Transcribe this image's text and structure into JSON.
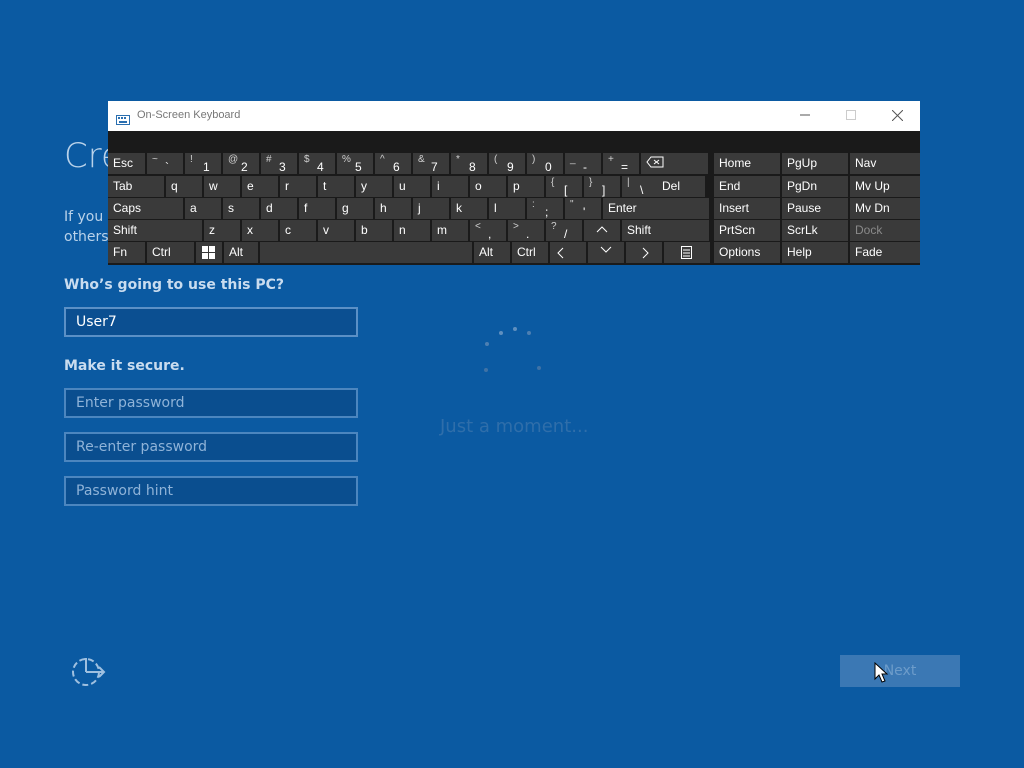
{
  "setup": {
    "title": "Cre",
    "subtitle_line1": "If you v",
    "subtitle_line2": "others",
    "who_label": "Who’s going to use this PC?",
    "username_value": "User7",
    "secure_label": "Make it secure.",
    "password_placeholder": "Enter password",
    "reenter_placeholder": "Re-enter password",
    "hint_placeholder": "Password hint",
    "next_label": "Next",
    "ease_icon": "ease-of-access-icon"
  },
  "overlay": {
    "message": "Just a moment..."
  },
  "osk": {
    "title": "On-Screen Keyboard",
    "icon": "keyboard-icon",
    "controls": [
      "minimize",
      "maximize",
      "close"
    ],
    "row1": {
      "esc": "Esc",
      "pairs": [
        {
          "shift": "~",
          "base": "`"
        },
        {
          "shift": "!",
          "base": "1"
        },
        {
          "shift": "@",
          "base": "2"
        },
        {
          "shift": "#",
          "base": "3"
        },
        {
          "shift": "$",
          "base": "4"
        },
        {
          "shift": "%",
          "base": "5"
        },
        {
          "shift": "^",
          "base": "6"
        },
        {
          "shift": "&",
          "base": "7"
        },
        {
          "shift": "*",
          "base": "8"
        },
        {
          "shift": "(",
          "base": "9"
        },
        {
          "shift": ")",
          "base": "0"
        },
        {
          "shift": "_",
          "base": "-"
        },
        {
          "shift": "+",
          "base": "="
        }
      ],
      "backspace_icon": "backspace-icon"
    },
    "row2": {
      "tab": "Tab",
      "letters": [
        "q",
        "w",
        "e",
        "r",
        "t",
        "y",
        "u",
        "i",
        "o",
        "p"
      ],
      "pairs": [
        {
          "shift": "{",
          "base": "["
        },
        {
          "shift": "}",
          "base": "]"
        },
        {
          "shift": "|",
          "base": "\\"
        }
      ],
      "del": "Del"
    },
    "row3": {
      "caps": "Caps",
      "letters": [
        "a",
        "s",
        "d",
        "f",
        "g",
        "h",
        "j",
        "k",
        "l"
      ],
      "pairs": [
        {
          "shift": ":",
          "base": ";"
        },
        {
          "shift": "\"",
          "base": "'"
        }
      ],
      "enter": "Enter"
    },
    "row4": {
      "shift_left": "Shift",
      "letters": [
        "z",
        "x",
        "c",
        "v",
        "b",
        "n",
        "m"
      ],
      "pairs": [
        {
          "shift": "<",
          "base": ","
        },
        {
          "shift": ">",
          "base": "."
        },
        {
          "shift": "?",
          "base": "/"
        }
      ],
      "shift_right": "Shift"
    },
    "row5": {
      "fn": "Fn",
      "ctrl_left": "Ctrl",
      "win_icon": "windows-logo-icon",
      "alt_left": "Alt",
      "alt_right": "Alt",
      "ctrl_right": "Ctrl",
      "menu_icon": "context-menu-icon"
    },
    "nav_block": [
      [
        "Home",
        "PgUp",
        "Nav"
      ],
      [
        "End",
        "PgDn",
        "Mv Up"
      ],
      [
        "Insert",
        "Pause",
        "Mv Dn"
      ],
      [
        "PrtScn",
        "ScrLk",
        "Dock"
      ],
      [
        "Options",
        "Help",
        "Fade"
      ]
    ]
  }
}
